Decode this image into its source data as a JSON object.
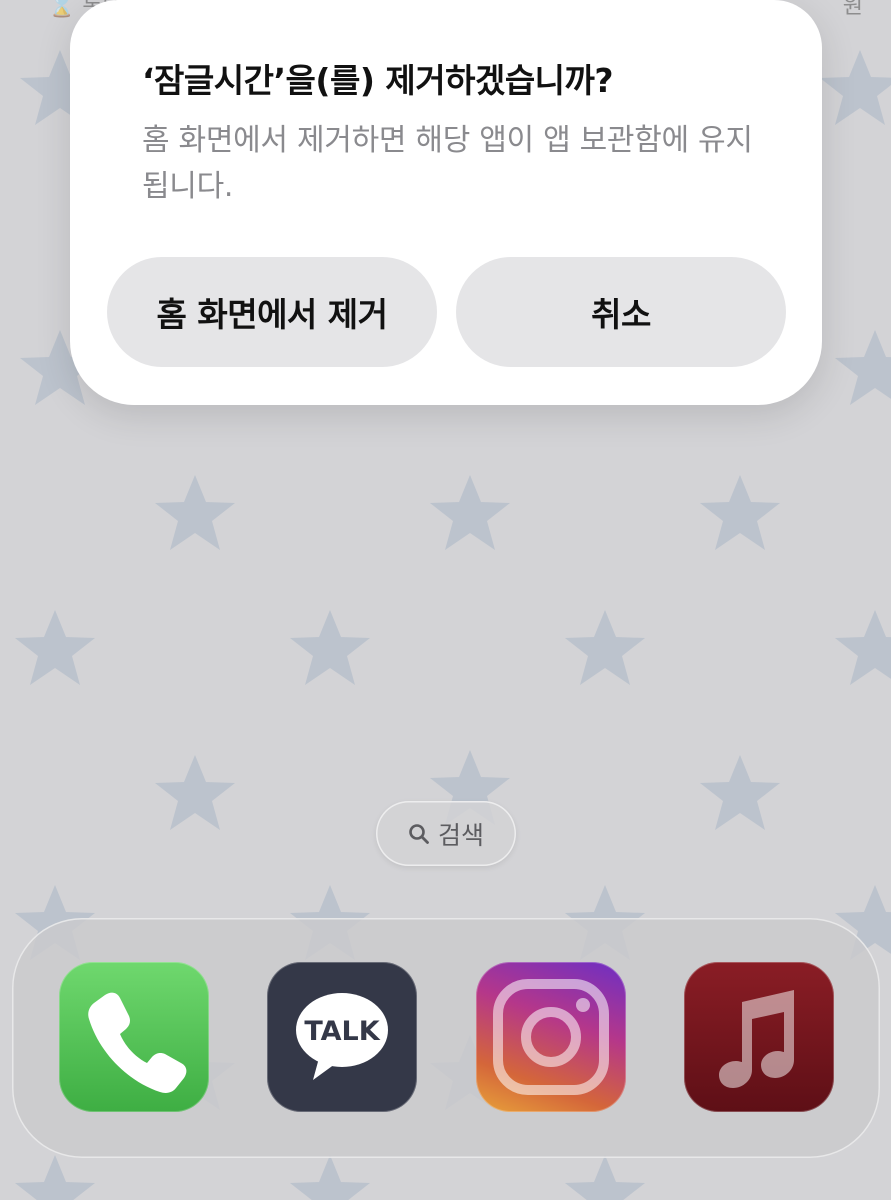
{
  "status_bar": {
    "left_fragment": "⌛ 롯데",
    "right_fragment": "원"
  },
  "alert": {
    "title": "‘잠글시간’을(를) 제거하겠습니까?",
    "message": "홈 화면에서 제거하면 해당 앱이 앱 보관함에 유지됩니다.",
    "remove_button_label": "홈 화면에서 제거",
    "cancel_button_label": "취소"
  },
  "search": {
    "label": "검색",
    "icon": "magnifying-glass-icon"
  },
  "dock": {
    "apps": [
      {
        "name": "Phone",
        "icon": "phone-icon",
        "color": "#4cc04f"
      },
      {
        "name": "KakaoTalk",
        "icon": "talk-bubble-icon",
        "badge_text": "TALK",
        "color": "#343848"
      },
      {
        "name": "Instagram",
        "icon": "camera-outline-icon",
        "color": "#b5378a"
      },
      {
        "name": "Music",
        "icon": "music-note-icon",
        "color": "#7a1820"
      }
    ]
  },
  "colors": {
    "wallpaper": "#d3d3d6",
    "stars": "#aab6c6",
    "alert_background": "#ffffff",
    "button_background": "#e5e5e7",
    "message_text": "#8a8a8e"
  }
}
